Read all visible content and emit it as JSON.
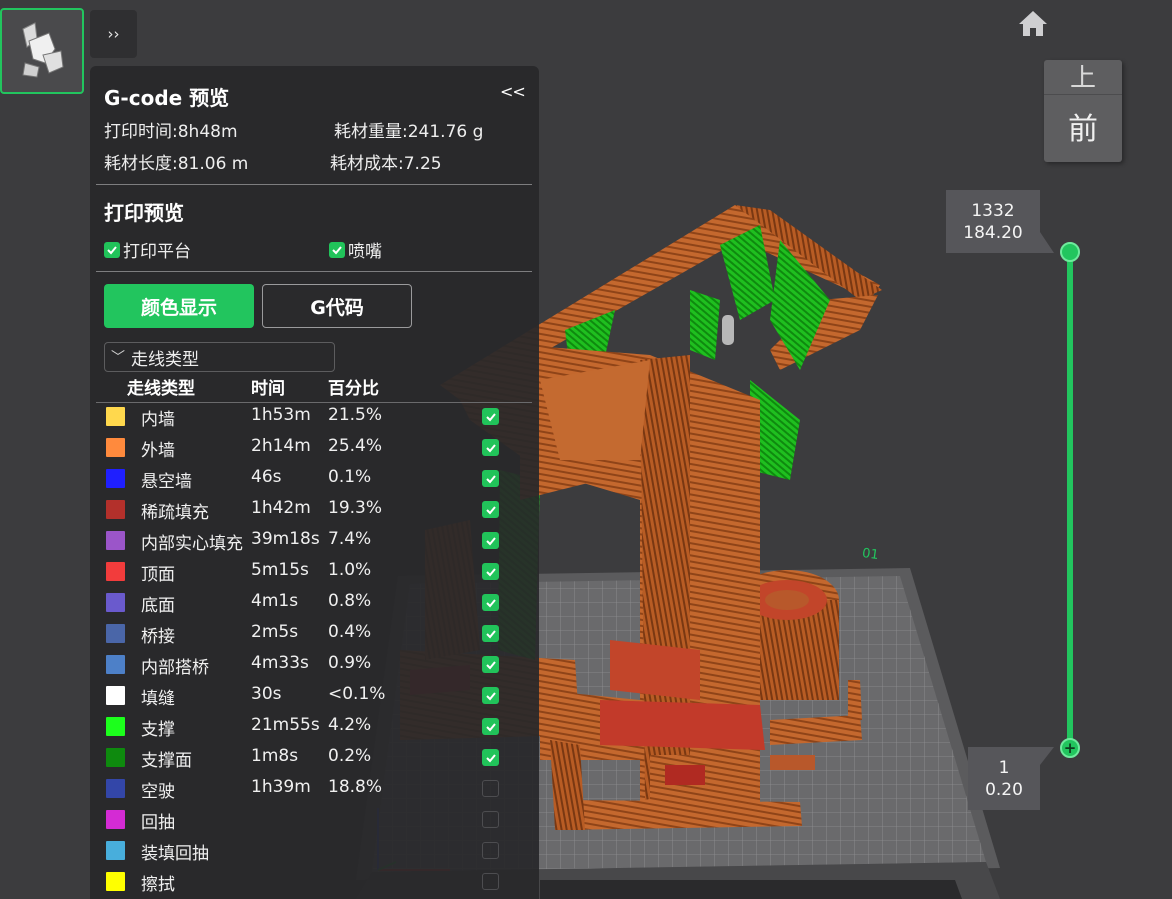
{
  "top_controls": {
    "expand_label": "››"
  },
  "view_cube": {
    "top_face": "上",
    "front_face": "前"
  },
  "panel": {
    "title": "G-code 预览",
    "collapse_label": "<<",
    "print_time": "打印时间:8h48m",
    "filament_weight": "耗材重量:241.76 g",
    "filament_length": "耗材长度:81.06 m",
    "filament_cost": "耗材成本:7.25",
    "preview_section": "打印预览",
    "toggle_bed": "打印平台",
    "toggle_nozzle": "喷嘴",
    "btn_color": "颜色显示",
    "btn_gcode": "G代码",
    "dropdown_value": "走线类型",
    "col_type": "走线类型",
    "col_time": "时间",
    "col_percent": "百分比",
    "rows": [
      {
        "name": "内墙",
        "time": "1h53m",
        "pct": "21.5%",
        "color": "#ffd84d",
        "checked": true
      },
      {
        "name": "外墙",
        "time": "2h14m",
        "pct": "25.4%",
        "color": "#ff8a3d",
        "checked": true
      },
      {
        "name": "悬空墙",
        "time": "46s",
        "pct": "0.1%",
        "color": "#1f1fff",
        "checked": true
      },
      {
        "name": "稀疏填充",
        "time": "1h42m",
        "pct": "19.3%",
        "color": "#b3302b",
        "checked": true
      },
      {
        "name": "内部实心填充",
        "time": "39m18s",
        "pct": "7.4%",
        "color": "#9b55c9",
        "checked": true
      },
      {
        "name": "顶面",
        "time": "5m15s",
        "pct": "1.0%",
        "color": "#f23c3c",
        "checked": true
      },
      {
        "name": "底面",
        "time": "4m1s",
        "pct": "0.8%",
        "color": "#6a5acd",
        "checked": true
      },
      {
        "name": "桥接",
        "time": "2m5s",
        "pct": "0.4%",
        "color": "#4a66a8",
        "checked": true
      },
      {
        "name": "内部搭桥",
        "time": "4m33s",
        "pct": "0.9%",
        "color": "#4d80c8",
        "checked": true
      },
      {
        "name": "填缝",
        "time": "30s",
        "pct": "<0.1%",
        "color": "#ffffff",
        "checked": true
      },
      {
        "name": "支撑",
        "time": "21m55s",
        "pct": "4.2%",
        "color": "#1cff1c",
        "checked": true
      },
      {
        "name": "支撑面",
        "time": "1m8s",
        "pct": "0.2%",
        "color": "#0e8a0e",
        "checked": true
      },
      {
        "name": "空驶",
        "time": "1h39m",
        "pct": "18.8%",
        "color": "#3346a8",
        "checked": false
      },
      {
        "name": "回抽",
        "time": "",
        "pct": "",
        "color": "#d42bd4",
        "checked": false
      },
      {
        "name": "装填回抽",
        "time": "",
        "pct": "",
        "color": "#48aedc",
        "checked": false
      },
      {
        "name": "擦拭",
        "time": "",
        "pct": "",
        "color": "#ffff00",
        "checked": false
      }
    ]
  },
  "layer_slider": {
    "top_layer": "1332",
    "top_height": "184.20",
    "bottom_layer": "1",
    "bottom_height": "0.20"
  },
  "plate_label": "01"
}
